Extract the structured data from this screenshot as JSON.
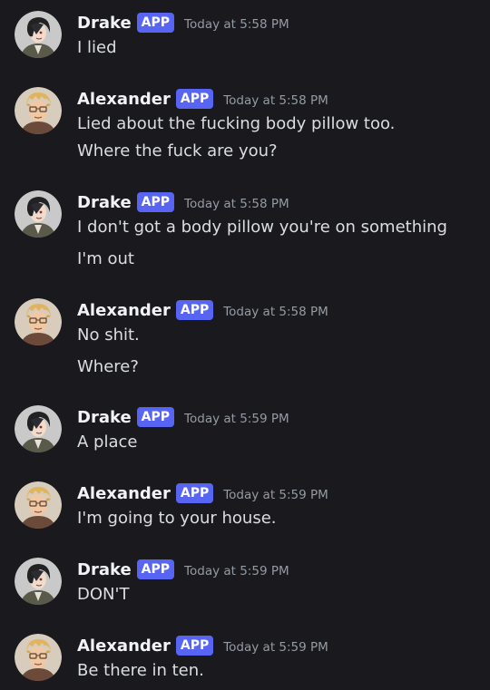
{
  "badge_label": "APP",
  "messages": [
    {
      "author": "Drake",
      "timestamp": "Today at 5:58 PM",
      "lines": [
        "I lied"
      ]
    },
    {
      "author": "Alexander",
      "timestamp": "Today at 5:58 PM",
      "lines": [
        "Lied about the fucking body pillow too.",
        "Where the fuck are you?"
      ]
    },
    {
      "author": "Drake",
      "timestamp": "Today at 5:58 PM",
      "lines": [
        "I don't got a body pillow you're on something",
        "I'm out"
      ]
    },
    {
      "author": "Alexander",
      "timestamp": "Today at 5:58 PM",
      "lines": [
        "No shit.",
        "Where?"
      ]
    },
    {
      "author": "Drake",
      "timestamp": "Today at 5:59 PM",
      "lines": [
        "A place"
      ]
    },
    {
      "author": "Alexander",
      "timestamp": "Today at 5:59 PM",
      "lines": [
        "I'm going to your house."
      ]
    },
    {
      "author": "Drake",
      "timestamp": "Today at 5:59 PM",
      "lines": [
        "DON'T"
      ]
    },
    {
      "author": "Alexander",
      "timestamp": "Today at 5:59 PM",
      "lines": [
        "Be there in ten."
      ]
    }
  ],
  "colors": {
    "background": "#1a1a1e",
    "app_badge": "#5865f2",
    "username": "#f2f3f5",
    "timestamp": "#949ba4",
    "message_text": "#dbdee1"
  }
}
